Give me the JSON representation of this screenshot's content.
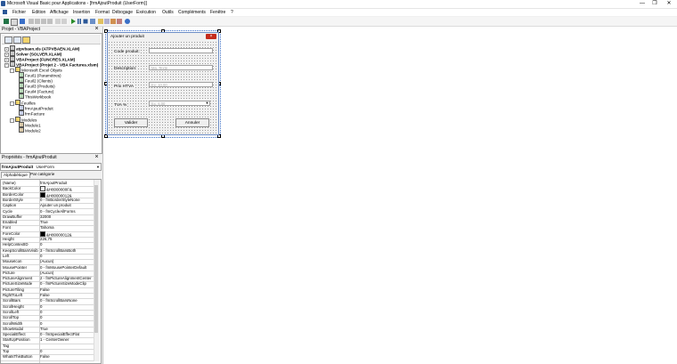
{
  "window": {
    "title": "Microsoft Visual Basic pour Applications - [frmAjoutProduit (UserForm)]",
    "minimize": "—",
    "restore": "❐",
    "close": "✕"
  },
  "menu": [
    {
      "label": "Fichier"
    },
    {
      "label": "Edition"
    },
    {
      "label": "Affichage"
    },
    {
      "label": "Insertion"
    },
    {
      "label": "Format"
    },
    {
      "label": "Débogage"
    },
    {
      "label": "Exécution"
    },
    {
      "label": "Outils"
    },
    {
      "label": "Compléments"
    },
    {
      "label": "Fenêtre"
    },
    {
      "label": "?"
    }
  ],
  "project": {
    "title": "Projet - VBAProject",
    "close": "×",
    "tree": [
      {
        "label": "atpvbaen.xls (ATPVBAEN.XLAM)",
        "bold": true
      },
      {
        "label": "Solver (SOLVER.XLAM)",
        "bold": true
      },
      {
        "label": "VBAProject (FUNCRES.XLAM)",
        "bold": true
      },
      {
        "label": "VBAProject (Projet 2 - VBA Factures.xlsm)",
        "bold": true
      },
      {
        "label": "Microsoft Excel Objets",
        "bold": false
      },
      {
        "label": "Feuil1 (Paramètres)",
        "bold": false
      },
      {
        "label": "Feuil2 (Clients)",
        "bold": false
      },
      {
        "label": "Feuil3 (Produits)",
        "bold": false
      },
      {
        "label": "Feuil4 (Facture)",
        "bold": false
      },
      {
        "label": "ThisWorkbook",
        "bold": false
      },
      {
        "label": "Feuilles",
        "bold": false
      },
      {
        "label": "frmAjoutProduit",
        "bold": false
      },
      {
        "label": "frmFacture",
        "bold": false
      },
      {
        "label": "Modules",
        "bold": false
      },
      {
        "label": "Module1",
        "bold": false
      },
      {
        "label": "Module2",
        "bold": false
      }
    ]
  },
  "properties": {
    "title": "Propriétés - frmAjoutProduit",
    "close": "×",
    "object_name": "frmAjoutProduit",
    "object_type": "UserForm",
    "tab_alpha": "Alphabétique",
    "tab_category": "Par catégorie",
    "rows": [
      {
        "name": "(Name)",
        "value": "frmAjoutProduit"
      },
      {
        "name": "BackColor",
        "value": "&H8000000F&",
        "swatch": "#f0f0f0"
      },
      {
        "name": "BorderColor",
        "value": "&H80000012&",
        "swatch": "#000000"
      },
      {
        "name": "BorderStyle",
        "value": "0 - fmBorderStyleNone"
      },
      {
        "name": "Caption",
        "value": "Ajouter un produit"
      },
      {
        "name": "Cycle",
        "value": "0 - fmCycleAllForms"
      },
      {
        "name": "DrawBuffer",
        "value": "32000"
      },
      {
        "name": "Enabled",
        "value": "True"
      },
      {
        "name": "Font",
        "value": "Tahoma"
      },
      {
        "name": "ForeColor",
        "value": "&H80000012&",
        "swatch": "#000000"
      },
      {
        "name": "Height",
        "value": "226,75"
      },
      {
        "name": "HelpContextID",
        "value": "0"
      },
      {
        "name": "KeepScrollBarsVisible",
        "value": "3 - fmScrollBarsBoth"
      },
      {
        "name": "Left",
        "value": "0"
      },
      {
        "name": "MouseIcon",
        "value": "(Aucun)"
      },
      {
        "name": "MousePointer",
        "value": "0 - fmMousePointerDefault"
      },
      {
        "name": "Picture",
        "value": "(Aucun)"
      },
      {
        "name": "PictureAlignment",
        "value": "2 - fmPictureAlignmentCenter"
      },
      {
        "name": "PictureSizeMode",
        "value": "0 - fmPictureSizeModeClip"
      },
      {
        "name": "PictureTiling",
        "value": "False"
      },
      {
        "name": "RightToLeft",
        "value": "False"
      },
      {
        "name": "ScrollBars",
        "value": "0 - fmScrollBarsNone"
      },
      {
        "name": "ScrollHeight",
        "value": "0"
      },
      {
        "name": "ScrollLeft",
        "value": "0"
      },
      {
        "name": "ScrollTop",
        "value": "0"
      },
      {
        "name": "ScrollWidth",
        "value": "0"
      },
      {
        "name": "ShowModal",
        "value": "True"
      },
      {
        "name": "SpecialEffect",
        "value": "0 - fmSpecialEffectFlat"
      },
      {
        "name": "StartUpPosition",
        "value": "1 - CenterOwner"
      },
      {
        "name": "Tag",
        "value": ""
      },
      {
        "name": "Top",
        "value": "0"
      },
      {
        "name": "WhatsThisButton",
        "value": "False"
      }
    ]
  },
  "form": {
    "caption": "Ajouter un produit",
    "close": "×",
    "labels": {
      "code": "Code produit:",
      "desc": "Description:",
      "price": "Prix HTVA",
      "vat": "TVA %"
    },
    "fields": {
      "code_value": "",
      "desc_value": "Ma. Texte",
      "price_value": "Ex: 10,00",
      "vat_value": "Ex: 6,00"
    },
    "buttons": {
      "ok": "Valider",
      "cancel": "Annuler"
    }
  }
}
